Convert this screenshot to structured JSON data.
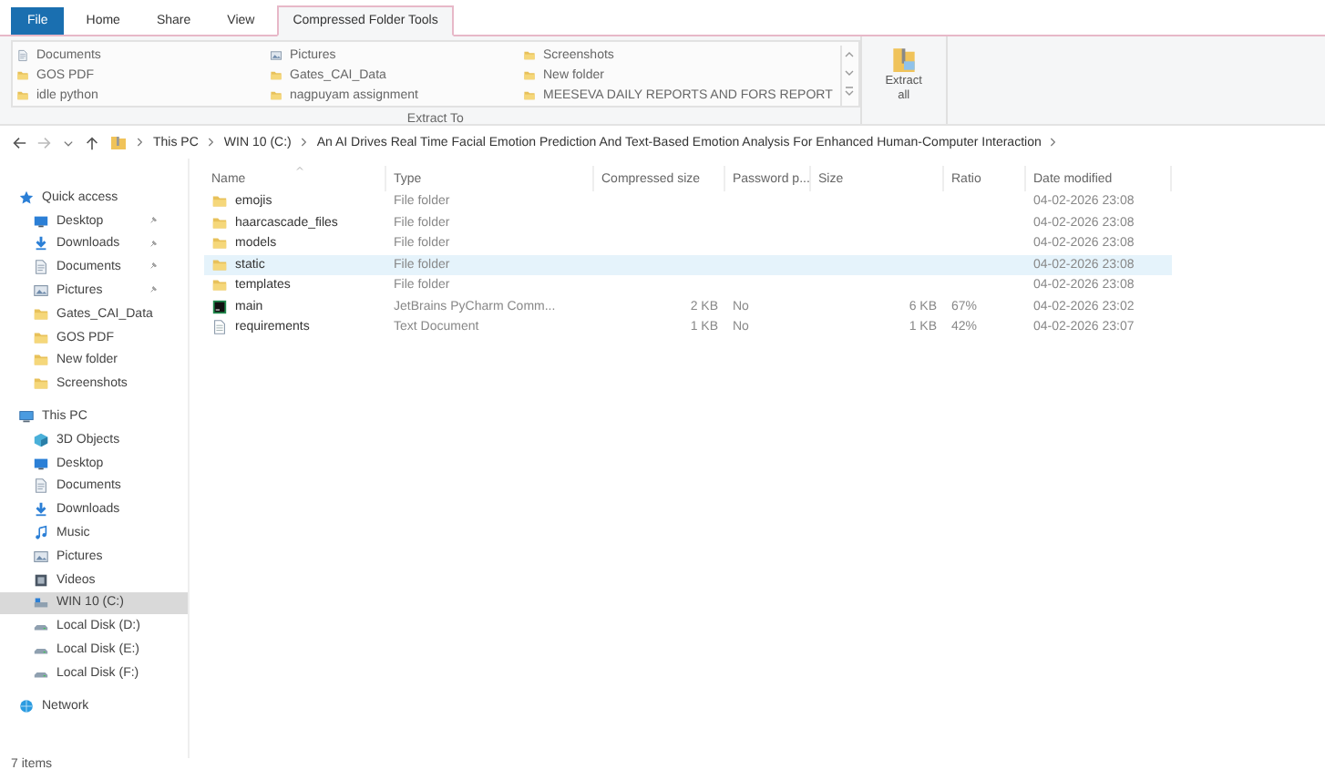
{
  "ribbon_tabs": [
    {
      "label": "File",
      "kind": "file",
      "selected": false
    },
    {
      "label": "Home",
      "kind": "tab",
      "selected": false
    },
    {
      "label": "Share",
      "kind": "tab",
      "selected": false
    },
    {
      "label": "View",
      "kind": "tab",
      "selected": false
    },
    {
      "label": "Compressed Folder Tools",
      "kind": "tab",
      "selected": true
    }
  ],
  "extract_to": {
    "columns": [
      [
        {
          "label": "Documents",
          "kind": "document"
        },
        {
          "label": "GOS PDF",
          "kind": "folder"
        },
        {
          "label": "idle python",
          "kind": "folder"
        }
      ],
      [
        {
          "label": "Pictures",
          "kind": "picture"
        },
        {
          "label": "Gates_CAI_Data",
          "kind": "folder"
        },
        {
          "label": "nagpuyam assignment",
          "kind": "folder"
        }
      ],
      [
        {
          "label": "Screenshots",
          "kind": "folder"
        },
        {
          "label": "New folder",
          "kind": "folder"
        },
        {
          "label": "MEESEVA DAILY REPORTS AND FORS REPORT",
          "kind": "folder"
        }
      ]
    ],
    "label": "Extract To"
  },
  "extract_all": "Extract all",
  "address": {
    "path": [
      "This PC",
      "WIN 10 (C:)",
      "An AI Drives Real Time Facial Emotion Prediction And Text-Based Emotion Analysis For Enhanced Human-Computer Interaction"
    ]
  },
  "navigation": [
    {
      "label": "Quick access",
      "kind": "star",
      "selected": false,
      "children": [
        {
          "label": "Desktop",
          "kind": "desktop",
          "pinned": true,
          "selected": false
        },
        {
          "label": "Downloads",
          "kind": "download",
          "pinned": true,
          "selected": false
        },
        {
          "label": "Documents",
          "kind": "document",
          "pinned": true,
          "selected": false
        },
        {
          "label": "Pictures",
          "kind": "picture",
          "pinned": true,
          "selected": false
        },
        {
          "label": "Gates_CAI_Data",
          "kind": "folder",
          "pinned": false,
          "selected": false
        },
        {
          "label": "GOS PDF",
          "kind": "folder",
          "pinned": false,
          "selected": false
        },
        {
          "label": "New folder",
          "kind": "folder",
          "pinned": false,
          "selected": false
        },
        {
          "label": "Screenshots",
          "kind": "folder",
          "pinned": false,
          "selected": false
        }
      ]
    },
    {
      "label": "This PC",
      "kind": "pc",
      "selected": false,
      "children": [
        {
          "label": "3D Objects",
          "kind": "cube",
          "selected": false
        },
        {
          "label": "Desktop",
          "kind": "desktop",
          "selected": false
        },
        {
          "label": "Documents",
          "kind": "document",
          "selected": false
        },
        {
          "label": "Downloads",
          "kind": "download",
          "selected": false
        },
        {
          "label": "Music",
          "kind": "music",
          "selected": false
        },
        {
          "label": "Pictures",
          "kind": "picture",
          "selected": false
        },
        {
          "label": "Videos",
          "kind": "video",
          "selected": false
        },
        {
          "label": "WIN 10 (C:)",
          "kind": "drive",
          "selected": true
        },
        {
          "label": "Local Disk (D:)",
          "kind": "disk",
          "selected": false
        },
        {
          "label": "Local Disk (E:)",
          "kind": "disk",
          "selected": false
        },
        {
          "label": "Local Disk (F:)",
          "kind": "disk",
          "selected": false
        }
      ]
    },
    {
      "label": "Network",
      "kind": "network",
      "selected": false
    }
  ],
  "file_list": {
    "columns": [
      "Name",
      "Type",
      "Compressed size",
      "Password p...",
      "Size",
      "Ratio",
      "Date modified"
    ],
    "rows": [
      {
        "name": "emojis",
        "kind": "folder",
        "type": "File folder",
        "date_modified": "04-02-2026 23:08",
        "selected": false
      },
      {
        "name": "haarcascade_files",
        "kind": "folder",
        "type": "File folder",
        "date_modified": "04-02-2026 23:08",
        "selected": false
      },
      {
        "name": "models",
        "kind": "folder",
        "type": "File folder",
        "date_modified": "04-02-2026 23:08",
        "selected": false
      },
      {
        "name": "static",
        "kind": "folder",
        "type": "File folder",
        "date_modified": "04-02-2026 23:08",
        "selected": true
      },
      {
        "name": "templates",
        "kind": "folder",
        "type": "File folder",
        "date_modified": "04-02-2026 23:08",
        "selected": false
      },
      {
        "name": "main",
        "kind": "pycharm",
        "type": "JetBrains PyCharm Comm...",
        "compressed_size": "2 KB",
        "password": "No",
        "size": "6 KB",
        "ratio": "67%",
        "date_modified": "04-02-2026 23:02",
        "selected": false
      },
      {
        "name": "requirements",
        "kind": "text",
        "type": "Text Document",
        "compressed_size": "1 KB",
        "password": "No",
        "size": "1 KB",
        "ratio": "42%",
        "date_modified": "04-02-2026 23:07",
        "selected": false
      }
    ]
  },
  "status_bar": "7 items"
}
